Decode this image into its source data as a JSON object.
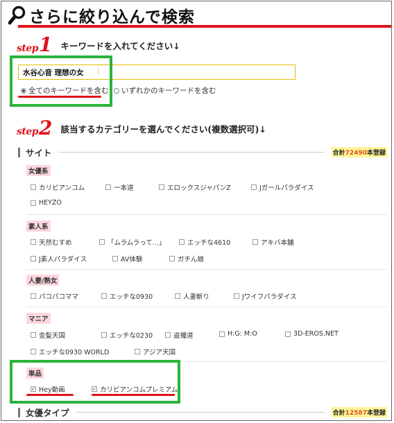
{
  "header": {
    "title": "さらに絞り込んで検索",
    "icon": "search-icon",
    "accent_color": "#e0121a"
  },
  "step1": {
    "word": "step",
    "number": "1",
    "text": "キーワードを入れてください↓",
    "keyword_value": "水谷心音 理想の女",
    "menu_glyph": "⋮",
    "radio_options": [
      {
        "label": "全てのキーワードを含む",
        "selected": true
      },
      {
        "label": "いずれかのキーワードを含む",
        "selected": false
      }
    ]
  },
  "step2": {
    "word": "step",
    "number": "2",
    "text": "該当するカテゴリーを選んでください(複数選択可)↓"
  },
  "site_section": {
    "label": "サイト",
    "count_prefix": "合計",
    "count": "72490",
    "count_suffix": "本登録",
    "groups": [
      {
        "label": "女優系",
        "items": [
          "カリビアンコム",
          "一本道",
          "エロックスジャパンZ",
          "Jガールパラダイス",
          "HEYZO"
        ]
      },
      {
        "label": "素人系",
        "items": [
          "天然むすめ",
          "「ムラムラって...」",
          "エッチな4610",
          "アキバ本舗",
          "J素人パラダイス",
          "AV体験",
          "ガチん娘"
        ]
      },
      {
        "label": "人妻/熟女",
        "items": [
          "パコパコママ",
          "エッチな0930",
          "人妻斬り",
          "Jワイフパラダイス"
        ]
      },
      {
        "label": "マニア",
        "items": [
          "金髪天国",
          "エッチな0230",
          "盗撮道",
          "H:G: M:O",
          "3D-EROS.NET",
          "エッチな0930 WORLD",
          "アジア天国"
        ]
      },
      {
        "label": "単品",
        "items": [
          "Hey動画",
          "カリビアンコムプレミアム"
        ],
        "checked": [
          true,
          true
        ]
      }
    ]
  },
  "actress_section": {
    "label": "女優タイプ",
    "count_prefix": "合計",
    "count": "12587",
    "count_suffix": "本登録"
  },
  "highlight_colors": {
    "green": "#2db33a",
    "red": "#e0121a",
    "category_bg": "#fbd7dd",
    "count_bg": "#fff59a"
  }
}
